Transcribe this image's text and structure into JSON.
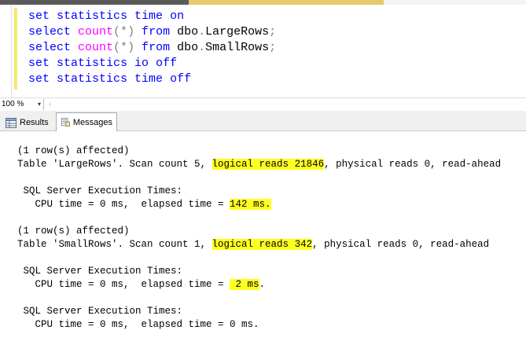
{
  "editor": {
    "lines": [
      {
        "kw1": "set",
        "kw2": " statistics",
        "kw3": " time",
        "kw4": " on"
      },
      {
        "select": "select",
        "count": " count",
        "lp": "(",
        "star": "*",
        "rp": ")",
        "from": " from",
        "obj": " dbo",
        "dot": ".",
        "tbl": "LargeRows",
        "semi": ";"
      },
      {
        "select": "select",
        "count": " count",
        "lp": "(",
        "star": "*",
        "rp": ")",
        "from": " from",
        "obj": " dbo",
        "dot": ".",
        "tbl": "SmallRows",
        "semi": ";"
      },
      {
        "kw1": "set",
        "kw2": " statistics",
        "kw3": " io",
        "kw4": " off"
      },
      {
        "kw1": "set",
        "kw2": " statistics",
        "kw3": " time",
        "kw4": " off"
      }
    ]
  },
  "zoom": {
    "value": "100 %",
    "arrow": "▾",
    "scroll_left": "‹"
  },
  "tabs": {
    "results": "Results",
    "messages": "Messages"
  },
  "messages": {
    "b1_affected": "(1 row(s) affected)",
    "b1_pre": "Table 'LargeRows'. Scan count 5, ",
    "b1_hl": "logical reads 21846",
    "b1_post": ", physical reads 0, read-ahead",
    "b1_exec": " SQL Server Execution Times:",
    "b1_cpu": "   CPU time = 0 ms,  elapsed time = ",
    "b1_elapsed": "142 ms.",
    "b2_affected": "(1 row(s) affected)",
    "b2_pre": "Table 'SmallRows'. Scan count 1, ",
    "b2_hl": "logical reads 342",
    "b2_post": ", physical reads 0, read-ahead",
    "b2_exec": " SQL Server Execution Times:",
    "b2_cpu": "   CPU time = 0 ms,  elapsed time = ",
    "b2_elapsed_hl": " 2 ms",
    "b2_elapsed_post": ".",
    "b3_exec": " SQL Server Execution Times:",
    "b3_cpu": "   CPU time = 0 ms,  elapsed time = 0 ms."
  },
  "colors": {
    "keyword": "#0000ff",
    "function": "#ff00ff",
    "operator": "#808080",
    "highlight": "#ffff20"
  }
}
